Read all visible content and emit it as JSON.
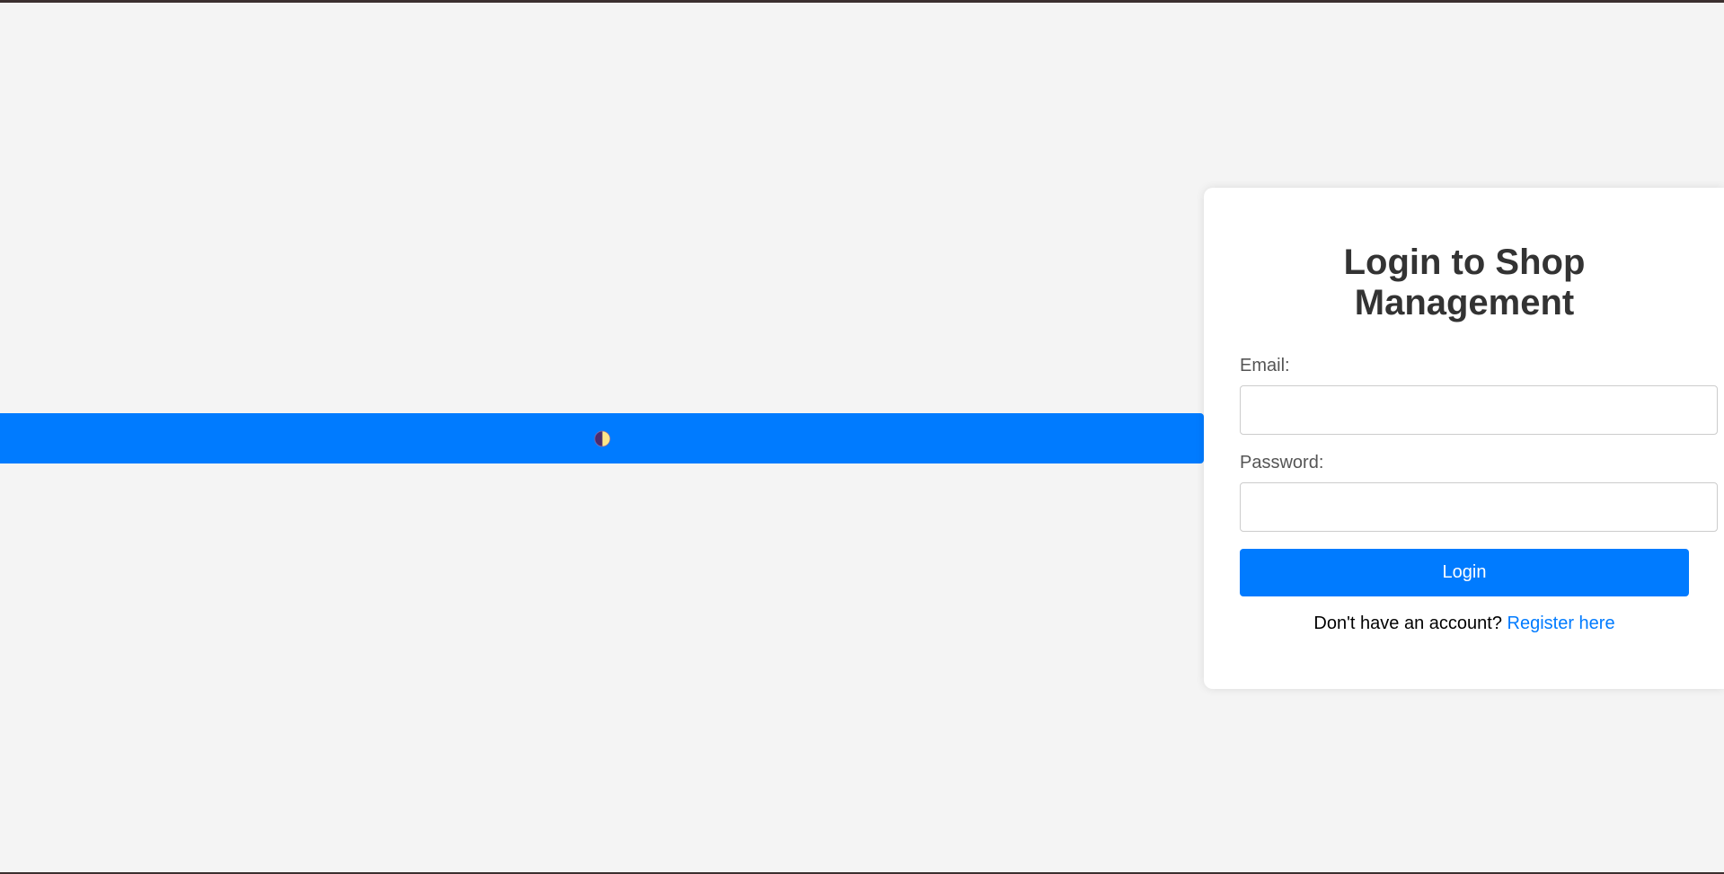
{
  "login": {
    "title": "Login to Shop Management",
    "email_label": "Email:",
    "email_value": "",
    "password_label": "Password:",
    "password_value": "",
    "login_button_label": "Login",
    "register_prompt": "Don't have an account?",
    "register_link_label": "Register here"
  },
  "theme_toggle": {
    "icon": "half-moon-icon"
  },
  "colors": {
    "page_background": "#f4f4f4",
    "accent": "#007bff",
    "card_background": "#ffffff",
    "title_text": "#333333",
    "label_text": "#555555",
    "link": "#007bff",
    "window_border": "#3b2f2f"
  }
}
